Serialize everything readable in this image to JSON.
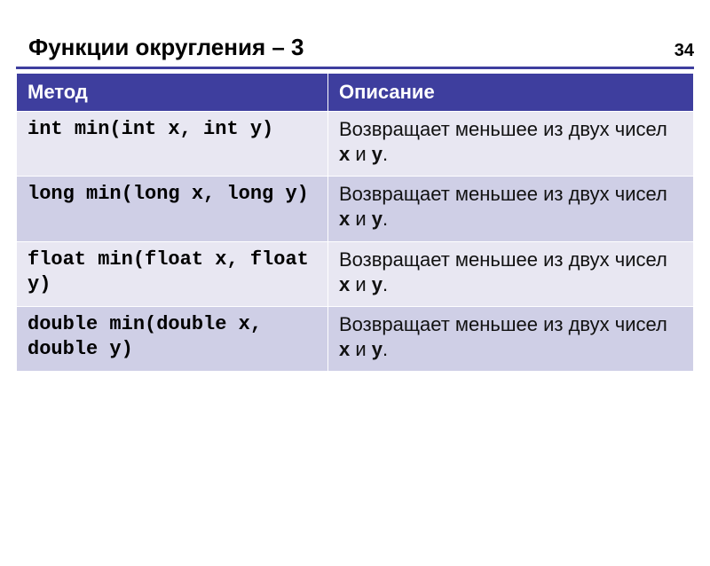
{
  "page_number": "34",
  "title": "Функции округления – 3",
  "headers": {
    "method": "Метод",
    "desc": "Описание"
  },
  "rows": [
    {
      "return_type": "int",
      "name": "min",
      "params": "(int x, int y)",
      "desc_a": "Возвращает меньшее из двух чисел ",
      "desc_x": "x",
      "desc_and": " и ",
      "desc_y": "y",
      "desc_end": "."
    },
    {
      "return_type": "long",
      "name": "min",
      "params": "(long x, long y)",
      "desc_a": "Возвращает меньшее из двух чисел ",
      "desc_x": "x",
      "desc_and": " и ",
      "desc_y": "y",
      "desc_end": "."
    },
    {
      "return_type": "float",
      "name": "min",
      "params": "(float x, float y)",
      "desc_a": "Возвращает меньшее из двух чисел ",
      "desc_x": "x",
      "desc_and": " и ",
      "desc_y": "y",
      "desc_end": "."
    },
    {
      "return_type": "double",
      "name": "min",
      "params": "(double x, double y)",
      "desc_a": "Возвращает меньшее из двух чисел ",
      "desc_x": "x",
      "desc_and": " и ",
      "desc_y": "y",
      "desc_end": "."
    }
  ]
}
